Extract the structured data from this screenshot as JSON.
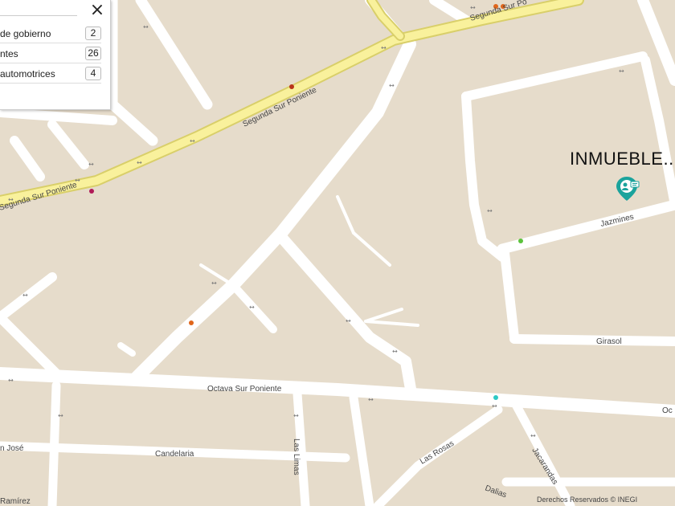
{
  "streets": {
    "segunda_sur_poniente": "Segunda Sur Poniente",
    "segunda_sur_po_cut": "Segunda Sur Po",
    "segunda_sur_poniente_left": "Segunda Sur Poniente",
    "octava_sur_poniente": "Octava Sur Poniente",
    "octava_right": "Oc",
    "jazmines": "Jazmines",
    "girasol": "Girasol",
    "candelaria": "Candelaria",
    "las_limas": "Las Limas",
    "las_rosas": "Las Rosas",
    "jacarandas": "Jacarandas",
    "dalias": "Dalias",
    "san_jose": "n José",
    "ramirez": "Ramírez"
  },
  "panel": {
    "close_label": "×",
    "items": [
      {
        "label": "de gobierno",
        "count": "2"
      },
      {
        "label": "ntes",
        "count": "26"
      },
      {
        "label": "automotrices",
        "count": "4"
      }
    ]
  },
  "map_title": "INMUEBLE..",
  "credit": "Derechos Reservados © INEGI",
  "colors": {
    "background": "#e6dccb",
    "road": "#ffffff",
    "highway": "#f9f19c",
    "highway_edge": "#d9cf6a",
    "marker": "#1ba39c"
  },
  "icons": {
    "close": "close-icon",
    "property_marker": "property-marker-icon"
  }
}
